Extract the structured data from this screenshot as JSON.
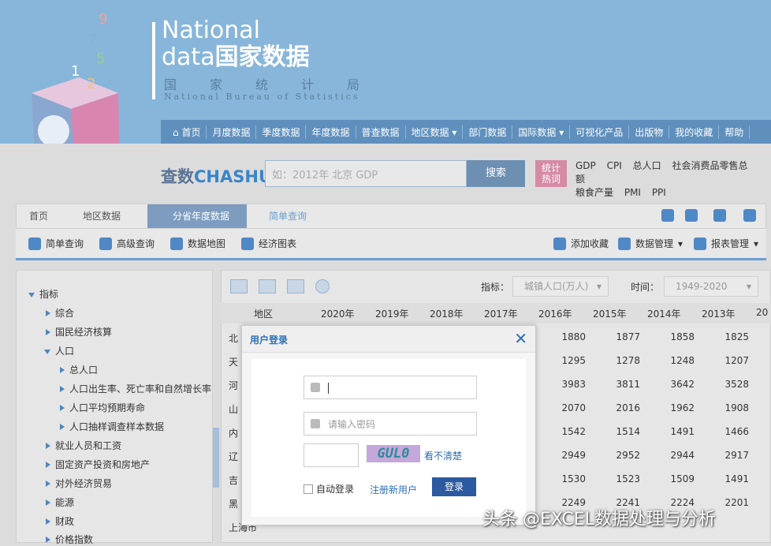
{
  "brand": {
    "en1": "National",
    "en2": "data",
    "cn": "国家数据",
    "bureau_cn": "国家统计局",
    "bureau_en": "National Bureau of Statistics"
  },
  "topnav": [
    "首页",
    "月度数据",
    "季度数据",
    "年度数据",
    "普查数据",
    "地区数据",
    "部门数据",
    "国际数据",
    "可视化产品",
    "出版物",
    "我的收藏",
    "帮助"
  ],
  "search": {
    "logo_cn": "查数",
    "logo_en": "CHASHU",
    "placeholder": "如：2012年 北京 GDP",
    "button": "搜索",
    "hot_label1": "统计",
    "hot_label2": "热词",
    "hot_words": [
      "GDP",
      "CPI",
      "总人口",
      "社会消费品零售总额",
      "粮食产量",
      "PMI",
      "PPI"
    ]
  },
  "breadcrumb": [
    "首页",
    "地区数据",
    "分省年度数据",
    "简单查询"
  ],
  "tools": {
    "simple": "简单查询",
    "advanced": "高级查询",
    "map": "数据地图",
    "chart": "经济图表",
    "fav": "添加收藏",
    "data_mgmt": "数据管理",
    "report_mgmt": "报表管理"
  },
  "tree": {
    "root": "指标",
    "items": [
      "综合",
      "国民经济核算",
      "人口",
      "总人口",
      "人口出生率、死亡率和自然增长率",
      "人口平均预期寿命",
      "人口抽样调查样本数据",
      "就业人员和工资",
      "固定资产投资和房地产",
      "对外经济贸易",
      "能源",
      "财政",
      "价格指数"
    ]
  },
  "filters": {
    "indicator_label": "指标：",
    "indicator_value": "城镇人口(万人)",
    "time_label": "时间：",
    "time_value": "1949-2020"
  },
  "table": {
    "region_header": "地区",
    "years": [
      "2020年",
      "2019年",
      "2018年",
      "2017年",
      "2016年",
      "2015年",
      "2014年",
      "2013年",
      "20"
    ],
    "regions": [
      "北",
      "天",
      "河",
      "山",
      "内",
      "辽",
      "吉",
      "黑",
      "上海市"
    ],
    "rows": [
      [
        "1880",
        "1877",
        "1858",
        "1825"
      ],
      [
        "1295",
        "1278",
        "1248",
        "1207"
      ],
      [
        "3983",
        "3811",
        "3642",
        "3528"
      ],
      [
        "2070",
        "2016",
        "1962",
        "1908"
      ],
      [
        "1542",
        "1514",
        "1491",
        "1466"
      ],
      [
        "2949",
        "2952",
        "2944",
        "2917"
      ],
      [
        "1530",
        "1523",
        "1509",
        "1491"
      ],
      [
        "2249",
        "2241",
        "2224",
        "2201"
      ]
    ]
  },
  "login": {
    "title": "用户登录",
    "close": "✕",
    "password_placeholder": "请输入密码",
    "captcha": "GUL0",
    "refresh": "看不清楚",
    "auto": "自动登录",
    "register": "注册新用户",
    "submit": "登录"
  },
  "watermark": "头条 @EXCEL数据处理与分析"
}
